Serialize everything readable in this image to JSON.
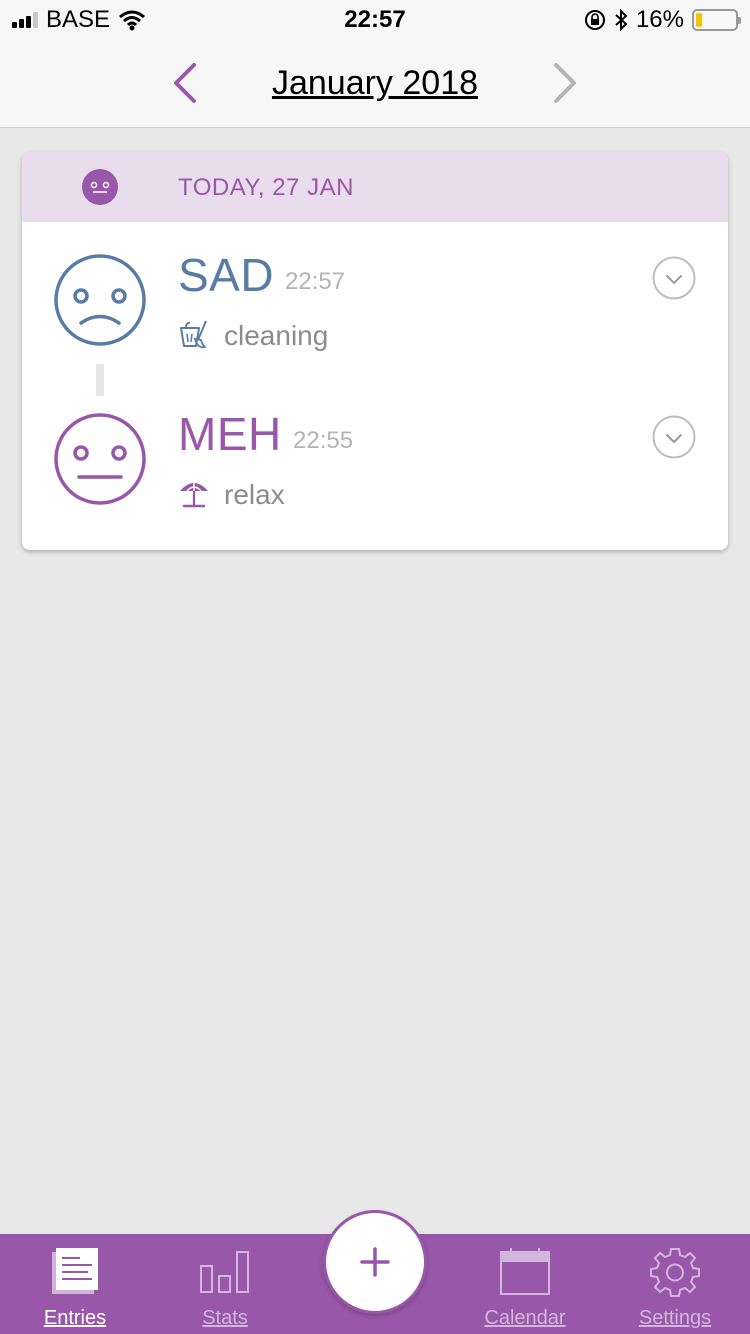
{
  "status_bar": {
    "carrier": "BASE",
    "time": "22:57",
    "battery_percent": "16%",
    "battery_level": 0.16,
    "icons": [
      "signal-icon",
      "wifi-icon",
      "orientation-lock-icon",
      "bluetooth-icon",
      "battery-icon"
    ]
  },
  "header": {
    "title": "January 2018",
    "prev_icon": "chevron-left-icon",
    "next_icon": "chevron-right-icon"
  },
  "day": {
    "label": "TODAY, 27 JAN",
    "mood_icon": "meh-face-icon",
    "entries": [
      {
        "mood": "SAD",
        "time": "22:57",
        "activity": "cleaning",
        "activity_icon": "cleaning-icon",
        "color": "#587ca6"
      },
      {
        "mood": "MEH",
        "time": "22:55",
        "activity": "relax",
        "activity_icon": "beach-umbrella-icon",
        "color": "#9857a8"
      }
    ]
  },
  "tab_bar": {
    "tabs": [
      {
        "label": "Entries",
        "icon": "entries-icon",
        "active": true
      },
      {
        "label": "Stats",
        "icon": "stats-icon",
        "active": false
      },
      {
        "label": "Calendar",
        "icon": "calendar-icon",
        "active": false
      },
      {
        "label": "Settings",
        "icon": "gear-icon",
        "active": false
      }
    ],
    "add_icon": "plus-icon"
  },
  "colors": {
    "accent": "#9857a8",
    "sad": "#587ca6",
    "header_bg": "#e9dcec",
    "background": "#e8e8e8"
  }
}
